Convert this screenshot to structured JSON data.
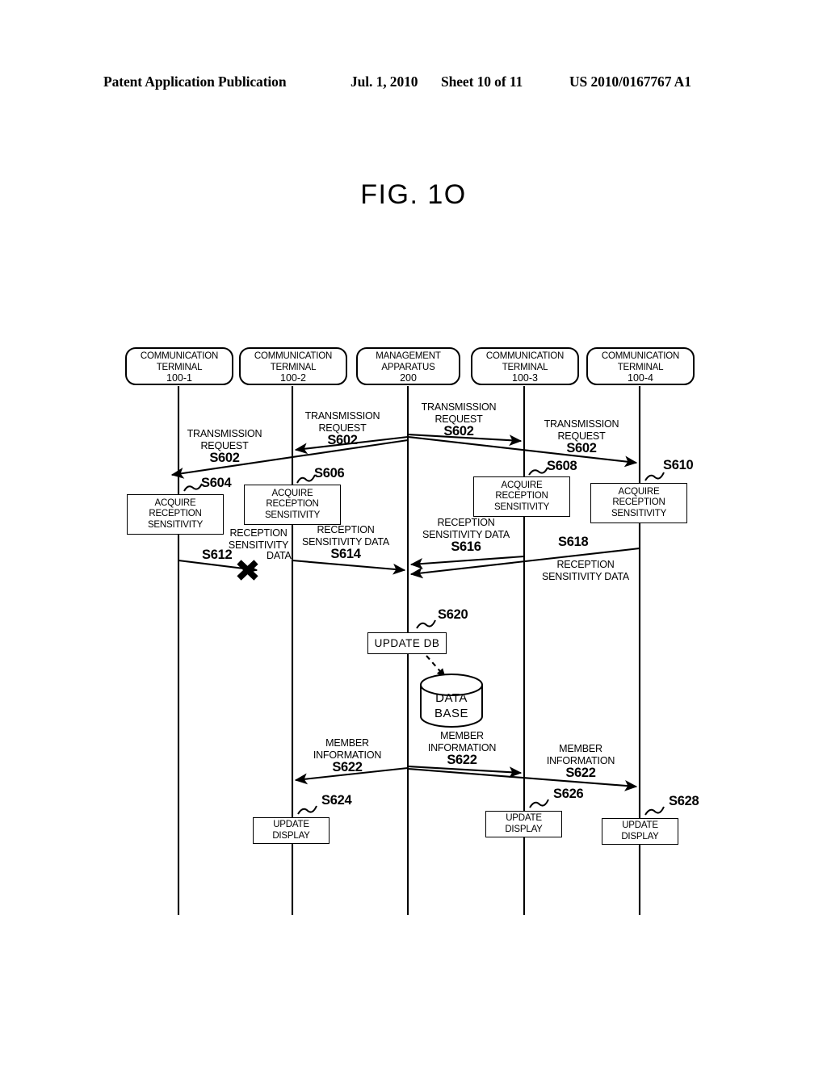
{
  "header": {
    "publication": "Patent Application Publication",
    "date": "Jul. 1, 2010",
    "sheet": "Sheet 10 of 11",
    "number": "US 2010/0167767 A1"
  },
  "figure": {
    "title": "FIG. 1O"
  },
  "lifelines": [
    {
      "id": "ct1",
      "line1": "COMMUNICATION",
      "line2": "TERMINAL",
      "line3": "100-1"
    },
    {
      "id": "ct2",
      "line1": "COMMUNICATION",
      "line2": "TERMINAL",
      "line3": "100-2"
    },
    {
      "id": "ma",
      "line1": "MANAGEMENT",
      "line2": "APPARATUS",
      "line3": "200"
    },
    {
      "id": "ct3",
      "line1": "COMMUNICATION",
      "line2": "TERMINAL",
      "line3": "100-3"
    },
    {
      "id": "ct4",
      "line1": "COMMUNICATION",
      "line2": "TERMINAL",
      "line3": "100-4"
    }
  ],
  "messages": [
    {
      "id": "m602a",
      "line1": "TRANSMISSION",
      "line2": "REQUEST",
      "step": "S602"
    },
    {
      "id": "m602b",
      "line1": "TRANSMISSION",
      "line2": "REQUEST",
      "step": "S602"
    },
    {
      "id": "m602c",
      "line1": "TRANSMISSION",
      "line2": "REQUEST",
      "step": "S602"
    },
    {
      "id": "m602d",
      "line1": "TRANSMISSION",
      "line2": "REQUEST",
      "step": "S602"
    },
    {
      "id": "m612",
      "line1": "RECEPTION",
      "line2": "SENSITIVITY",
      "line3": "DATA",
      "step": "S612"
    },
    {
      "id": "m614",
      "line1": "RECEPTION",
      "line2": "SENSITIVITY  DATA",
      "step": "S614"
    },
    {
      "id": "m616",
      "line1": "RECEPTION",
      "line2": "SENSITIVITY  DATA",
      "step": "S616"
    },
    {
      "id": "m618",
      "line1": "RECEPTION",
      "line2": "SENSITIVITY  DATA",
      "step": "S618"
    },
    {
      "id": "m622a",
      "line1": "MEMBER",
      "line2": "INFORMATION",
      "step": "S622"
    },
    {
      "id": "m622b",
      "line1": "MEMBER",
      "line2": "INFORMATION",
      "step": "S622"
    },
    {
      "id": "m622c",
      "line1": "MEMBER",
      "line2": "INFORMATION",
      "step": "S622"
    }
  ],
  "process_boxes": [
    {
      "id": "p604",
      "line1": "ACQUIRE",
      "line2": "RECEPTION",
      "line3": "SENSITIVITY",
      "step": "S604"
    },
    {
      "id": "p606",
      "line1": "ACQUIRE",
      "line2": "RECEPTION",
      "line3": "SENSITIVITY",
      "step": "S606"
    },
    {
      "id": "p608",
      "line1": "ACQUIRE",
      "line2": "RECEPTION",
      "line3": "SENSITIVITY",
      "step": "S608"
    },
    {
      "id": "p610",
      "line1": "ACQUIRE",
      "line2": "RECEPTION",
      "line3": "SENSITIVITY",
      "step": "S610"
    },
    {
      "id": "p620",
      "label": "UPDATE  DB",
      "step": "S620"
    },
    {
      "id": "p624",
      "line1": "UPDATE",
      "line2": "DISPLAY",
      "step": "S624"
    },
    {
      "id": "p626",
      "line1": "UPDATE",
      "line2": "DISPLAY",
      "step": "S626"
    },
    {
      "id": "p628",
      "line1": "UPDATE",
      "line2": "DISPLAY",
      "step": "S628"
    }
  ],
  "database": {
    "line1": "DATA",
    "line2": "BASE"
  },
  "colors": {
    "ink": "#000000",
    "paper": "#ffffff"
  }
}
